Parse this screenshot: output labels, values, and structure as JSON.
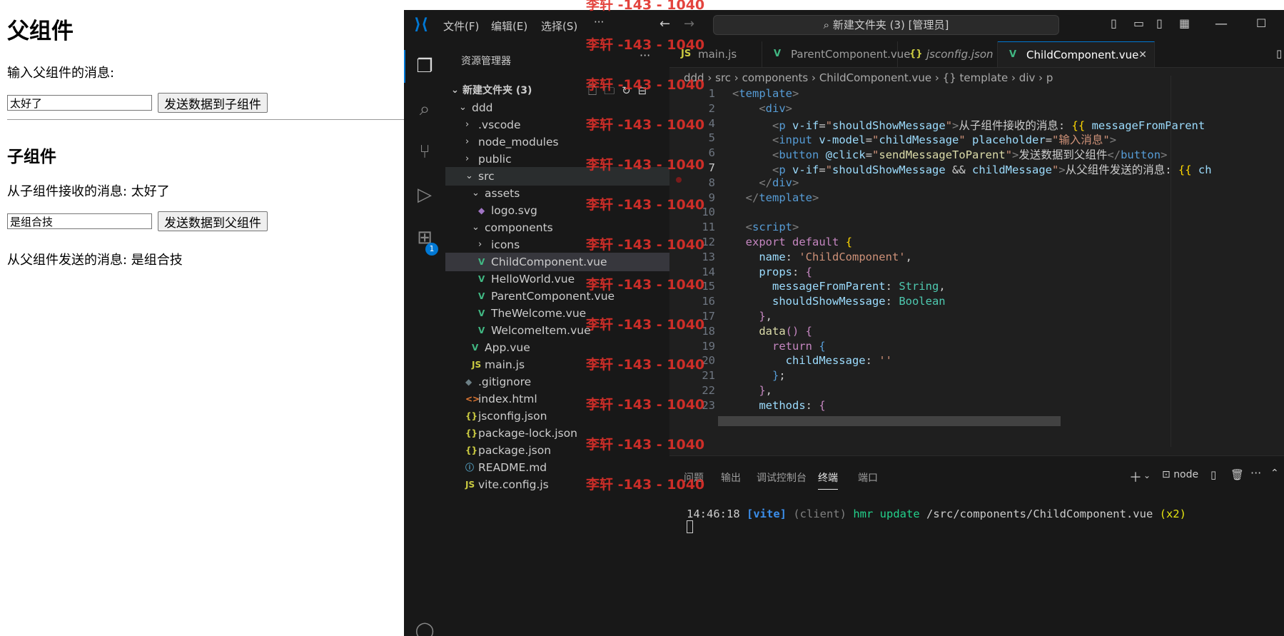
{
  "page": {
    "parent_heading": "父组件",
    "parent_prompt": "输入父组件的消息:",
    "parent_input_value": "太好了",
    "parent_button": "发送数据到子组件",
    "child_heading": "子组件",
    "child_received": "从子组件接收的消息: 太好了",
    "child_input_value": "是组合技",
    "child_button": "发送数据到父组件",
    "parent_received": "从父组件发送的消息: 是组合技"
  },
  "vscode": {
    "menu": [
      "文件(F)",
      "编辑(E)",
      "选择(S)",
      "···"
    ],
    "command_center": "新建文件夹 (3) [管理员]",
    "accent_color": "#0078d4",
    "explorer": {
      "title": "资源管理器",
      "more": "···",
      "root": "新建文件夹 (3)",
      "items": [
        {
          "label": "ddd",
          "depth": 1,
          "kind": "folder-open",
          "icon": ""
        },
        {
          "label": ".vscode",
          "depth": 2,
          "kind": "folder",
          "icon": ""
        },
        {
          "label": "node_modules",
          "depth": 2,
          "kind": "folder",
          "icon": ""
        },
        {
          "label": "public",
          "depth": 2,
          "kind": "folder",
          "icon": ""
        },
        {
          "label": "src",
          "depth": 2,
          "kind": "folder-open",
          "icon": ""
        },
        {
          "label": "assets",
          "depth": 3,
          "kind": "folder-open",
          "icon": ""
        },
        {
          "label": "logo.svg",
          "depth": 4,
          "kind": "file",
          "icon": "svg"
        },
        {
          "label": "components",
          "depth": 3,
          "kind": "folder-open",
          "icon": ""
        },
        {
          "label": "icons",
          "depth": 4,
          "kind": "folder",
          "icon": ""
        },
        {
          "label": "ChildComponent.vue",
          "depth": 4,
          "kind": "file",
          "icon": "vue"
        },
        {
          "label": "HelloWorld.vue",
          "depth": 4,
          "kind": "file",
          "icon": "vue"
        },
        {
          "label": "ParentComponent.vue",
          "depth": 4,
          "kind": "file",
          "icon": "vue"
        },
        {
          "label": "TheWelcome.vue",
          "depth": 4,
          "kind": "file",
          "icon": "vue"
        },
        {
          "label": "WelcomeItem.vue",
          "depth": 4,
          "kind": "file",
          "icon": "vue"
        },
        {
          "label": "App.vue",
          "depth": 3,
          "kind": "file",
          "icon": "vue"
        },
        {
          "label": "main.js",
          "depth": 3,
          "kind": "file",
          "icon": "js"
        },
        {
          "label": ".gitignore",
          "depth": 2,
          "kind": "file",
          "icon": "git"
        },
        {
          "label": "index.html",
          "depth": 2,
          "kind": "file",
          "icon": "html"
        },
        {
          "label": "jsconfig.json",
          "depth": 2,
          "kind": "file",
          "icon": "json"
        },
        {
          "label": "package-lock.json",
          "depth": 2,
          "kind": "file",
          "icon": "json"
        },
        {
          "label": "package.json",
          "depth": 2,
          "kind": "file",
          "icon": "json"
        },
        {
          "label": "README.md",
          "depth": 2,
          "kind": "file",
          "icon": "info"
        },
        {
          "label": "vite.config.js",
          "depth": 2,
          "kind": "file",
          "icon": "js"
        }
      ]
    },
    "badge_count": "1",
    "tabs": [
      {
        "label": "main.js",
        "icon": "JS",
        "active": false,
        "italic": false
      },
      {
        "label": "ParentComponent.vue",
        "icon": "V",
        "active": false,
        "italic": false
      },
      {
        "label": "jsconfig.json",
        "icon": "{}",
        "active": false,
        "italic": true
      },
      {
        "label": "ChildComponent.vue",
        "icon": "V",
        "active": true,
        "italic": false
      }
    ],
    "breadcrumb": [
      "ddd",
      "src",
      "components",
      "ChildComponent.vue",
      "{} template",
      "div",
      "p"
    ],
    "code_lines": [
      {
        "n": "1",
        "html": "<span class='t'>&lt;</span><span class='k'>template</span><span class='t'>&gt;</span>"
      },
      {
        "n": "2",
        "html": "    <span class='t'>&lt;</span><span class='k'>div</span><span class='t'>&gt;</span>"
      },
      {
        "n": "4",
        "html": "      <span class='t'>&lt;</span><span class='k'>p</span> <span class='a'>v-if</span>=<span class='s'>\"</span><span class='a'>shouldShowMessage</span><span class='s'>\"</span><span class='t'>&gt;</span>从子组件接收的消息: <span class='y'>{{</span> <span class='a'>messageFromParent</span>"
      },
      {
        "n": "5",
        "html": "      <span class='t'>&lt;</span><span class='k'>input</span> <span class='a'>v-model</span>=<span class='s'>\"</span><span class='a'>childMessage</span><span class='s'>\"</span> <span class='a'>placeholder</span>=<span class='s'>\"输入消息\"</span><span class='t'>&gt;</span>"
      },
      {
        "n": "6",
        "html": "      <span class='t'>&lt;</span><span class='k'>button</span> <span class='a'>@click</span>=<span class='s'>\"</span><span class='f'>sendMessageToParent</span><span class='s'>\"</span><span class='t'>&gt;</span>发送数据到父组件<span class='t'>&lt;/</span><span class='k'>button</span><span class='t'>&gt;</span>"
      },
      {
        "n": "7",
        "html": "      <span class='t'>&lt;</span><span class='k'>p</span> <span class='a'>v-if</span>=<span class='s'>\"</span><span class='a'>shouldShowMessage</span> &amp;&amp; <span class='a'>childMessage</span><span class='s'>\"</span><span class='t'>&gt;</span>从父组件发送的消息: <span class='y'>{{</span> <span class='a'>ch</span>"
      },
      {
        "n": "8",
        "html": "    <span class='t'>&lt;/</span><span class='k'>div</span><span class='t'>&gt;</span>"
      },
      {
        "n": "9",
        "html": "  <span class='t'>&lt;/</span><span class='k'>template</span><span class='t'>&gt;</span>"
      },
      {
        "n": "10",
        "html": ""
      },
      {
        "n": "11",
        "html": "  <span class='t'>&lt;</span><span class='k'>script</span><span class='t'>&gt;</span>"
      },
      {
        "n": "12",
        "html": "  <span class='p'>export</span> <span class='p'>default</span> <span class='y'>{</span>"
      },
      {
        "n": "13",
        "html": "    <span class='a'>name</span>: <span class='s'>'ChildComponent'</span>,"
      },
      {
        "n": "14",
        "html": "    <span class='a'>props</span>: <span class='p'>{</span>"
      },
      {
        "n": "15",
        "html": "      <span class='a'>messageFromParent</span>: <span class='g'>String</span>,"
      },
      {
        "n": "16",
        "html": "      <span class='a'>shouldShowMessage</span>: <span class='g'>Boolean</span>"
      },
      {
        "n": "17",
        "html": "    <span class='p'>}</span>,"
      },
      {
        "n": "18",
        "html": "    <span class='f'>data</span><span class='p'>()</span> <span class='p'>{</span>"
      },
      {
        "n": "19",
        "html": "      <span class='p'>return</span> <span class='b'>{</span>"
      },
      {
        "n": "20",
        "html": "        <span class='a'>childMessage</span>: <span class='s'>''</span>"
      },
      {
        "n": "21",
        "html": "      <span class='b'>}</span>;"
      },
      {
        "n": "22",
        "html": "    <span class='p'>}</span>,"
      },
      {
        "n": "23",
        "html": "    <span class='a'>methods</span>: <span class='p'>{</span>"
      }
    ],
    "panel_tabs": [
      "问题",
      "输出",
      "调试控制台",
      "终端",
      "端口"
    ],
    "active_panel_tab": "终端",
    "terminal_shell": "node",
    "terminal": {
      "time": "14:46:18",
      "tag": "[vite]",
      "client": "(client)",
      "action": "hmr update",
      "path": "/src/components/ChildComponent.vue",
      "count": "(x2)"
    }
  },
  "watermark": "李轩 -143 - 1040"
}
